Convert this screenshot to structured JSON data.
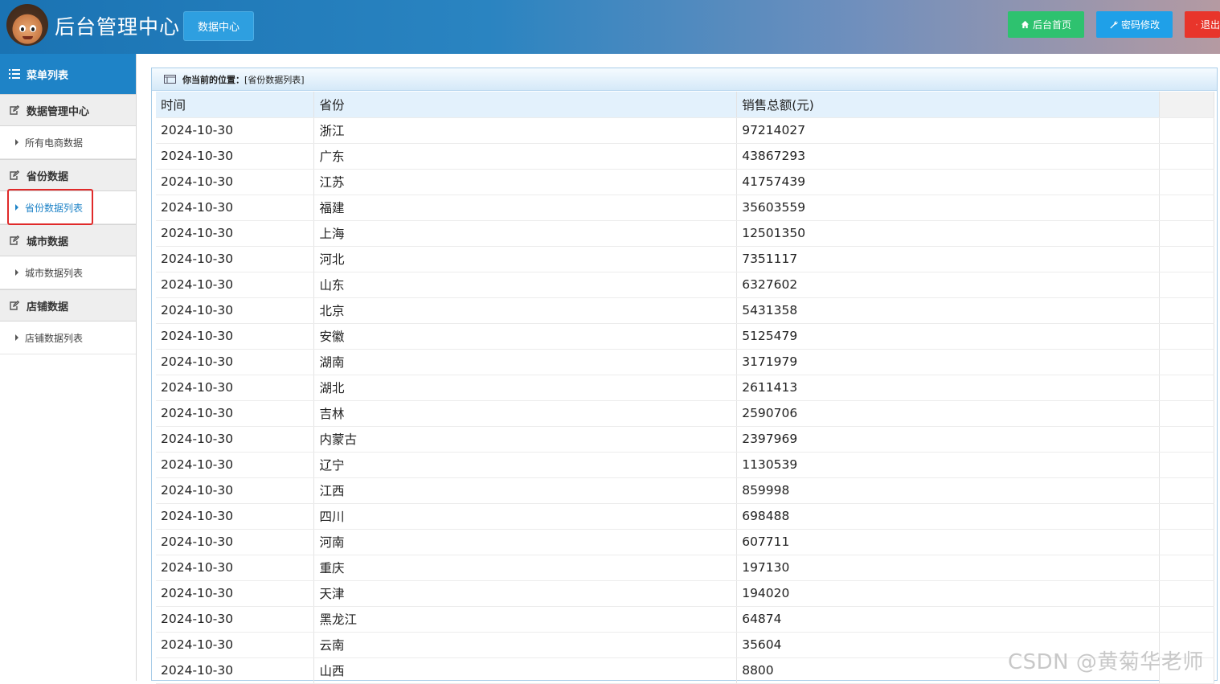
{
  "header": {
    "title": "后台管理中心",
    "data_center": "数据中心",
    "home": "后台首页",
    "password": "密码修改",
    "logout": "退出"
  },
  "sidebar": {
    "menu_title": "菜单列表",
    "groups": [
      {
        "label": "数据管理中心",
        "items": [
          {
            "label": "所有电商数据"
          }
        ]
      },
      {
        "label": "省份数据",
        "items": [
          {
            "label": "省份数据列表",
            "active": true
          }
        ]
      },
      {
        "label": "城市数据",
        "items": [
          {
            "label": "城市数据列表"
          }
        ]
      },
      {
        "label": "店铺数据",
        "items": [
          {
            "label": "店铺数据列表"
          }
        ]
      }
    ]
  },
  "breadcrumb": {
    "label": "你当前的位置：",
    "value": "[省份数据列表]"
  },
  "table": {
    "headers": [
      "时间",
      "省份",
      "销售总额(元)"
    ],
    "rows": [
      [
        "2024-10-30",
        "浙江",
        "97214027"
      ],
      [
        "2024-10-30",
        "广东",
        "43867293"
      ],
      [
        "2024-10-30",
        "江苏",
        "41757439"
      ],
      [
        "2024-10-30",
        "福建",
        "35603559"
      ],
      [
        "2024-10-30",
        "上海",
        "12501350"
      ],
      [
        "2024-10-30",
        "河北",
        "7351117"
      ],
      [
        "2024-10-30",
        "山东",
        "6327602"
      ],
      [
        "2024-10-30",
        "北京",
        "5431358"
      ],
      [
        "2024-10-30",
        "安徽",
        "5125479"
      ],
      [
        "2024-10-30",
        "湖南",
        "3171979"
      ],
      [
        "2024-10-30",
        "湖北",
        "2611413"
      ],
      [
        "2024-10-30",
        "吉林",
        "2590706"
      ],
      [
        "2024-10-30",
        "内蒙古",
        "2397969"
      ],
      [
        "2024-10-30",
        "辽宁",
        "1130539"
      ],
      [
        "2024-10-30",
        "江西",
        "859998"
      ],
      [
        "2024-10-30",
        "四川",
        "698488"
      ],
      [
        "2024-10-30",
        "河南",
        "607711"
      ],
      [
        "2024-10-30",
        "重庆",
        "197130"
      ],
      [
        "2024-10-30",
        "天津",
        "194020"
      ],
      [
        "2024-10-30",
        "黑龙江",
        "64874"
      ],
      [
        "2024-10-30",
        "云南",
        "35604"
      ],
      [
        "2024-10-30",
        "山西",
        "8800"
      ]
    ]
  },
  "watermark": "CSDN @黄菊华老师",
  "colors": {
    "sidebar_blue": "#1e83c7",
    "home_green": "#2ec26f",
    "pwd_blue": "#1fa0e8",
    "logout_red": "#e8352b",
    "highlight_red": "#e02a2a"
  }
}
